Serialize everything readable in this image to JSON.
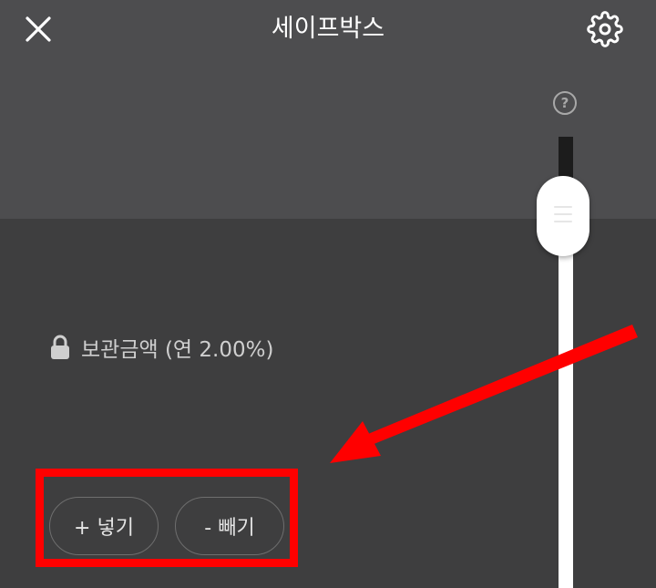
{
  "header": {
    "title": "세이프박스",
    "close_icon": "close-icon",
    "settings_icon": "gear-icon"
  },
  "slider": {
    "help_text": "?",
    "help_icon": "question-circle-icon"
  },
  "main": {
    "amount_label": "보관금액 (연 2.00%)",
    "lock_icon": "lock-icon"
  },
  "actions": {
    "add_label": "+ 넣기",
    "withdraw_label": "- 빼기"
  },
  "annotation": {
    "color": "#ff0000"
  },
  "colors": {
    "top_bg": "#4d4d4f",
    "bottom_bg": "#3e3e3f",
    "accent": "#ff0000"
  }
}
